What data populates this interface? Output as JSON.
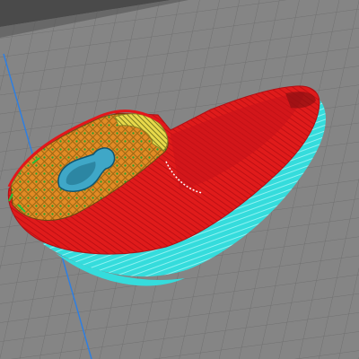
{
  "viewer": {
    "scene": "slicer-layer-preview",
    "colors": {
      "background": "#4a4a4a",
      "bed": "#858585",
      "grid": "#6f6f6f",
      "axis_z": "#2f7fe0",
      "skirt": "#35dcdc",
      "outer_wall": "#e4161b",
      "top_surface": "#e01b1b",
      "infill": "#e0902a",
      "support": "#e5e53a",
      "travel": "#23c43a",
      "bridge": "#3fa7c7",
      "seam": "#ffffff"
    }
  }
}
